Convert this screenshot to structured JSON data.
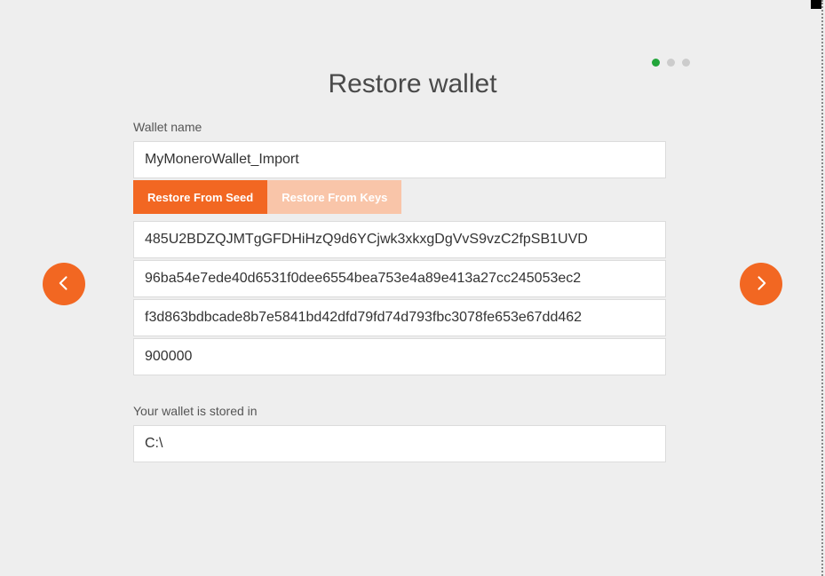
{
  "title": "Restore wallet",
  "steps": {
    "count": 3,
    "current": 0
  },
  "labels": {
    "wallet_name": "Wallet name",
    "storage": "Your wallet is stored in"
  },
  "tabs": {
    "seed": "Restore From Seed",
    "keys": "Restore From Keys",
    "active": "seed"
  },
  "fields": {
    "wallet_name": "MyMoneroWallet_Import",
    "address": "485U2BDZQJMTgGFDHiHzQ9d6YCjwk3xkxgDgVvS9vzC2fpSB1UVD",
    "view_key": "96ba54e7ede40d6531f0dee6554bea753e4a89e413a27cc245053ec2",
    "spend_key": "f3d863bdbcade8b7e5841bd42dfd79fd74d793fbc3078fe653e67dd462",
    "restore_height": "900000",
    "storage_path": "C:\\"
  }
}
